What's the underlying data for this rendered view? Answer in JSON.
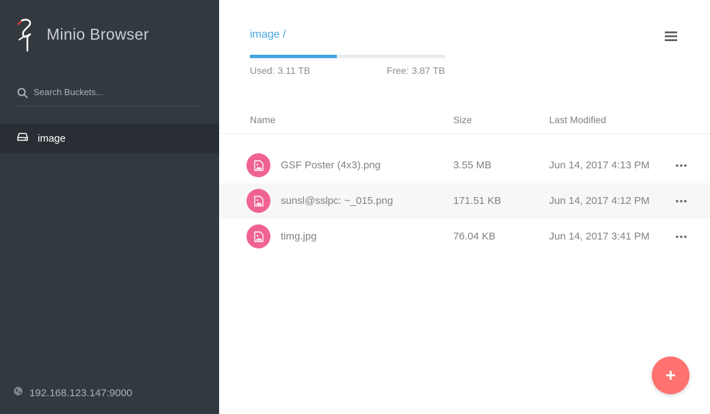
{
  "sidebar": {
    "logo_text": "Minio Browser",
    "search_placeholder": "Search Buckets...",
    "buckets": [
      {
        "label": "image",
        "icon": "hard-drive-icon"
      }
    ],
    "host": "192.168.123.147:9000"
  },
  "main": {
    "breadcrumb": {
      "bucket": "image",
      "separator": "/"
    },
    "storage": {
      "used_label": "Used: 3.11 TB",
      "free_label": "Free: 3.87 TB",
      "used_fraction": 0.445
    },
    "table": {
      "headers": {
        "name": "Name",
        "size": "Size",
        "modified": "Last Modified"
      },
      "rows": [
        {
          "name": "GSF Poster (4x3).png",
          "size": "3.55 MB",
          "modified": "Jun 14, 2017 4:13 PM",
          "icon": "image-file-icon"
        },
        {
          "name": "sunsl@sslpc: ~_015.png",
          "size": "171.51 KB",
          "modified": "Jun 14, 2017 4:12 PM",
          "icon": "image-file-icon"
        },
        {
          "name": "timg.jpg",
          "size": "76.04 KB",
          "modified": "Jun 14, 2017 3:41 PM",
          "icon": "image-file-icon"
        }
      ]
    },
    "fab_label": "+"
  },
  "colors": {
    "sidebar_bg": "#32393f",
    "sidebar_active": "#282e33",
    "accent": "#46a5e0",
    "file_icon": "#f06292",
    "fab": "#ff726f"
  }
}
